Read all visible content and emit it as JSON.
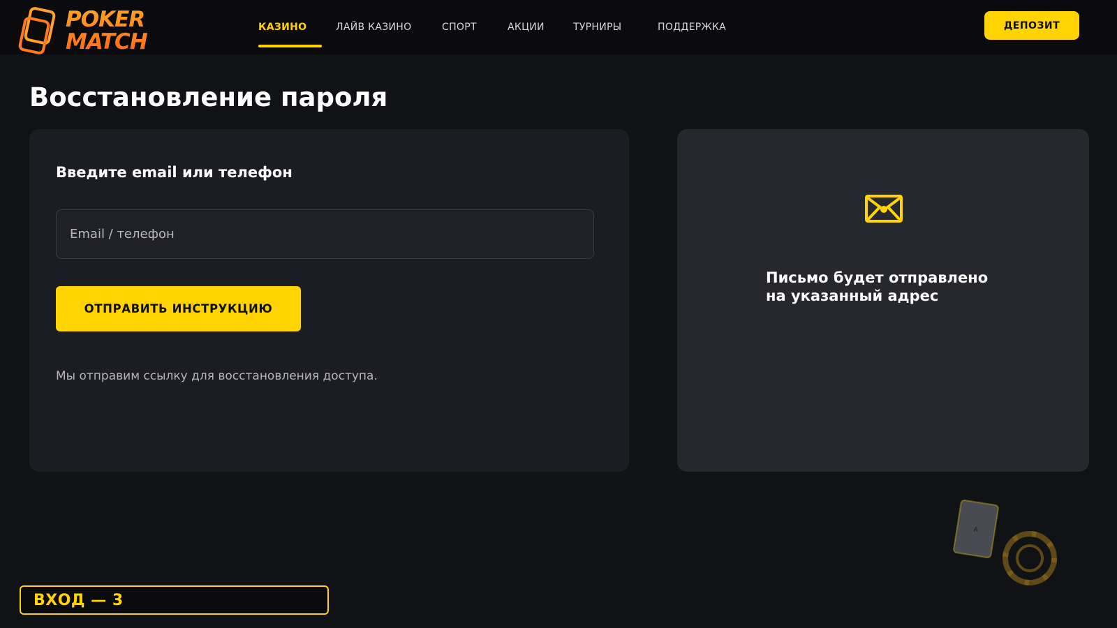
{
  "brand": {
    "logo_line1": "POKER",
    "logo_line2": "MATCH",
    "logo_color": "#ff8c1a"
  },
  "nav": {
    "items": [
      {
        "label": "КАЗИНО",
        "active": true
      },
      {
        "label": "ЛАЙВ КАЗИНО",
        "active": false
      },
      {
        "label": "СПОРТ",
        "active": false
      },
      {
        "label": "АКЦИИ",
        "active": false
      },
      {
        "label": "ТУРНИРЫ",
        "active": false
      },
      {
        "label": "ПОДДЕРЖКА",
        "active": false
      }
    ],
    "deposit_label": "ДЕПОЗИТ"
  },
  "page": {
    "title": "Восстановление пароля"
  },
  "form": {
    "heading": "Введите email или телефон",
    "input_placeholder": "Email / телефон",
    "input_value": "",
    "submit_label": "ОТПРАВИТЬ ИНСТРУКЦИЮ",
    "note": "Мы отправим ссылку для восстановления доступа."
  },
  "info": {
    "icon": "envelope-icon",
    "line1": "Письмо будет отправлено",
    "line2": "на указанный адрес"
  },
  "decor": {
    "card_rank": "A",
    "icons": [
      "playing-card-icon",
      "poker-chip-icon"
    ]
  },
  "login_badge": {
    "label": "ВХОД — 3"
  },
  "colors": {
    "accent": "#ffd400",
    "background": "#111216",
    "header_bg": "#0b0b0d",
    "card_bg": "#1c1d22",
    "info_card_bg": "#27282d"
  }
}
